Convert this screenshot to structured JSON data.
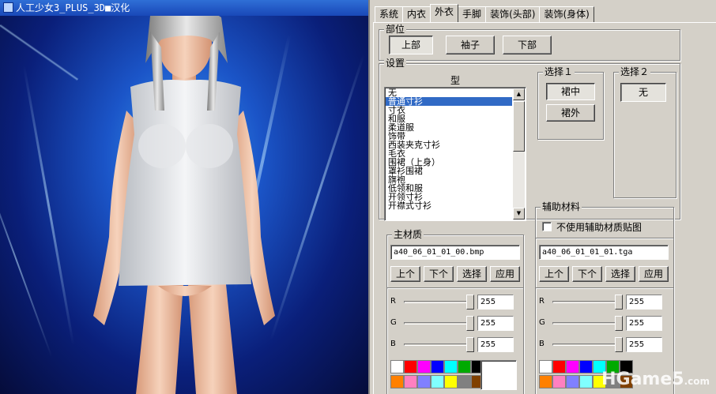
{
  "window": {
    "title": "人工少女3_PLUS_3D■汉化"
  },
  "tabs": [
    "系统",
    "内衣",
    "外衣",
    "手脚",
    "装饰(头部)",
    "装饰(身体)"
  ],
  "active_tab": "外衣",
  "part": {
    "label": "部位",
    "buttons": [
      "上部",
      "袖子",
      "下部"
    ],
    "selected": "上部"
  },
  "settings": {
    "label": "设置",
    "type_header": "型",
    "items": [
      "无",
      "普通寸衫",
      "寸衣",
      "和服",
      "柔道服",
      "饰带",
      "西装夹克寸衫",
      "毛衣",
      "围裙（上身）",
      "罩衫围裙",
      "旗袍",
      "低领和服",
      "开领寸衫",
      "开襟式寸衫"
    ],
    "selected_index": 1
  },
  "choice1": {
    "label": "选择１",
    "buttons": [
      "裙中",
      "裙外"
    ],
    "selected": "裙中"
  },
  "choice2": {
    "label": "选择２",
    "button": "无"
  },
  "main_material": {
    "label": "主材质",
    "file": "a40_06_01_01_00.bmp",
    "buttons": [
      "上个",
      "下个",
      "选择",
      "应用"
    ]
  },
  "aux_material": {
    "label": "辅助材料",
    "checkbox_label": "不使用辅助材质贴图",
    "checked": false,
    "file": "a40_06_01_01_01.tga",
    "buttons": [
      "上个",
      "下个",
      "选择",
      "应用"
    ]
  },
  "main_rgb": [
    {
      "channel": "R",
      "value": "255"
    },
    {
      "channel": "G",
      "value": "255"
    },
    {
      "channel": "B",
      "value": "255"
    }
  ],
  "aux_rgb": [
    {
      "channel": "R",
      "value": "255"
    },
    {
      "channel": "G",
      "value": "255"
    },
    {
      "channel": "B",
      "value": "255"
    }
  ],
  "palette_colors": [
    "#ffffff",
    "#ff0000",
    "#ff00ff",
    "#0000ff",
    "#00ffff",
    "#00aa00",
    "#000000",
    "#ff8000",
    "#ff80c0",
    "#8080ff",
    "#80ffff",
    "#ffff00",
    "#808080",
    "#804000"
  ],
  "watermark": {
    "brand": "HGame5",
    "suffix": ".com"
  }
}
